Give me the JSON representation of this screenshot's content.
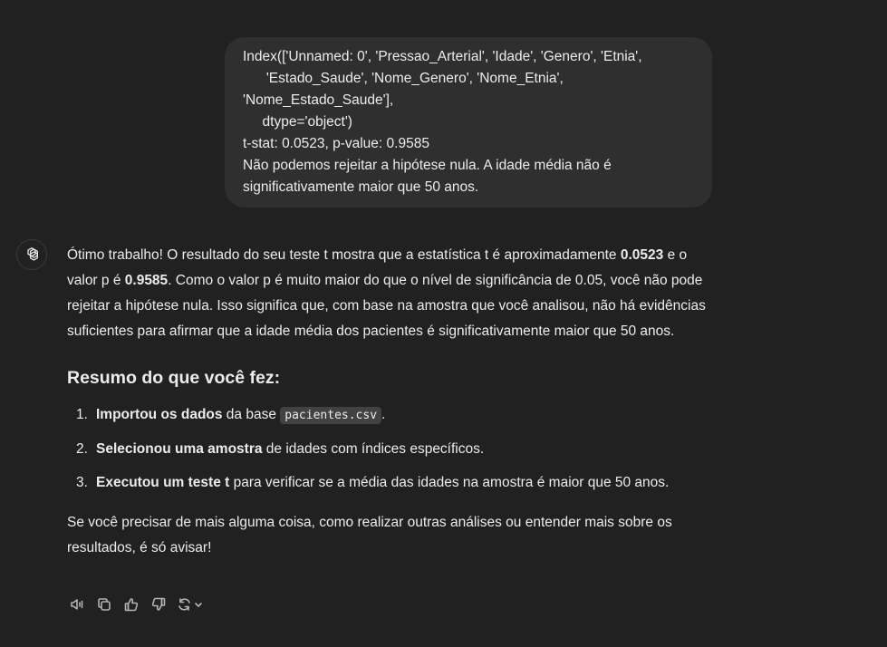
{
  "user_message": {
    "lines": [
      "Index(['Unnamed: 0', 'Pressao_Arterial', 'Idade', 'Genero', 'Etnia',",
      "      'Estado_Saude', 'Nome_Genero', 'Nome_Etnia',",
      "'Nome_Estado_Saude'],",
      "     dtype='object')",
      "t-stat: 0.0523, p-value: 0.9585",
      "Não podemos rejeitar a hipótese nula. A idade média não é",
      "significativamente maior que 50 anos."
    ]
  },
  "assistant": {
    "avatar_icon": "openai-logo-icon",
    "intro_part1": "Ótimo trabalho! O resultado do seu teste t mostra que a estatística t é aproximadamente ",
    "intro_bold1": "0.0523",
    "intro_part2": " e o valor p é ",
    "intro_bold2": "0.9585",
    "intro_part3": ". Como o valor p é muito maior do que o nível de significância de 0.05, você não pode rejeitar a hipótese nula. Isso significa que, com base na amostra que você analisou, não há evidências suficientes para afirmar que a idade média dos pacientes é significativamente maior que 50 anos.",
    "summary_title": "Resumo do que você fez:",
    "steps": [
      {
        "num": "1.",
        "bold": "Importou os dados",
        "text": " da base ",
        "code": "pacientes.csv",
        "after": "."
      },
      {
        "num": "2.",
        "bold": "Selecionou uma amostra",
        "text": " de idades com índices específicos.",
        "code": "",
        "after": ""
      },
      {
        "num": "3.",
        "bold": "Executou um teste t",
        "text": " para verificar se a média das idades na amostra é maior que 50 anos.",
        "code": "",
        "after": ""
      }
    ],
    "closing": "Se você precisar de mais alguma coisa, como realizar outras análises ou entender mais sobre os resultados, é só avisar!"
  },
  "actions": [
    {
      "name": "read-aloud-icon"
    },
    {
      "name": "copy-icon"
    },
    {
      "name": "thumbs-up-icon"
    },
    {
      "name": "thumbs-down-icon"
    },
    {
      "name": "regenerate-icon"
    }
  ],
  "colors": {
    "background": "#212121",
    "user_bubble": "#2f2f2f",
    "text": "#ececec",
    "icon": "#b4b4b4"
  }
}
